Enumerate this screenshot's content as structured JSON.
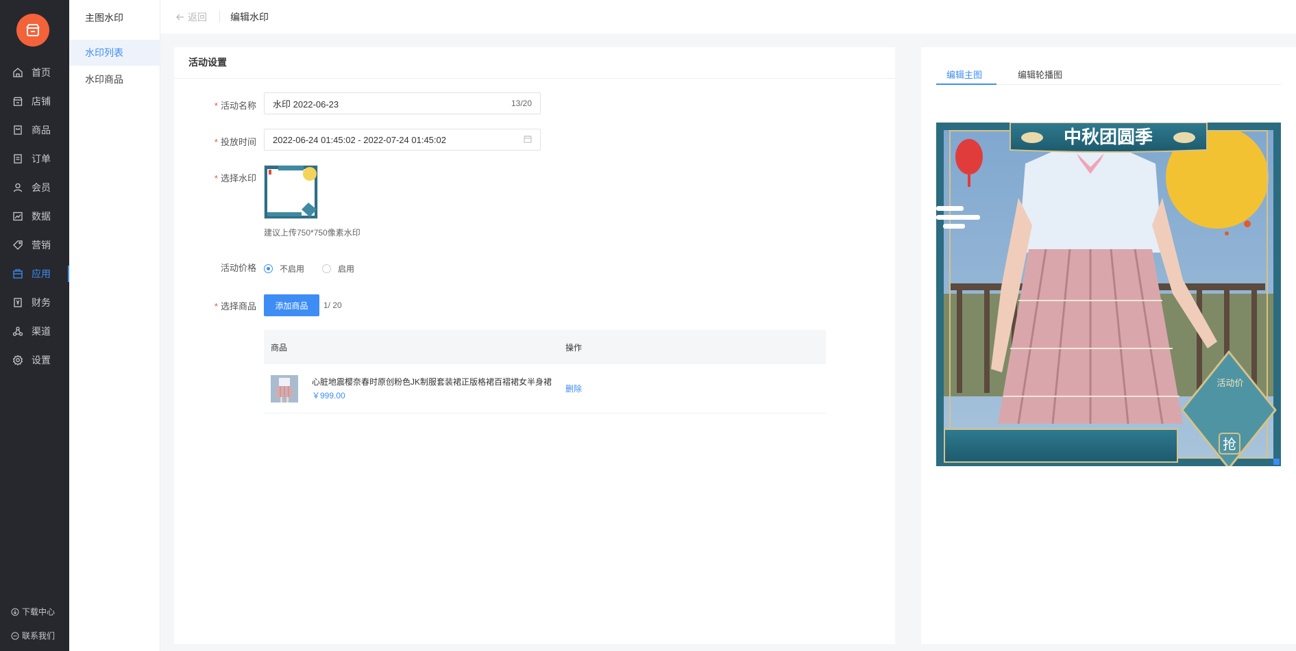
{
  "nav": {
    "items": [
      {
        "label": "首页",
        "icon": "home-icon"
      },
      {
        "label": "店铺",
        "icon": "store-icon"
      },
      {
        "label": "商品",
        "icon": "product-icon"
      },
      {
        "label": "订单",
        "icon": "order-icon"
      },
      {
        "label": "会员",
        "icon": "member-icon"
      },
      {
        "label": "数据",
        "icon": "chart-icon"
      },
      {
        "label": "营销",
        "icon": "tag-icon"
      },
      {
        "label": "应用",
        "icon": "app-icon",
        "active": true
      },
      {
        "label": "财务",
        "icon": "finance-icon"
      },
      {
        "label": "渠道",
        "icon": "channel-icon"
      },
      {
        "label": "设置",
        "icon": "gear-icon"
      }
    ],
    "footer": {
      "download": "下载中心",
      "contact": "联系我们"
    }
  },
  "subnav": {
    "title": "主图水印",
    "items": [
      {
        "label": "水印列表",
        "active": true
      },
      {
        "label": "水印商品"
      }
    ]
  },
  "topbar": {
    "back": "返回",
    "title": "编辑水印"
  },
  "form": {
    "card_title": "活动设置",
    "name_label": "活动名称",
    "name_value": "水印 2022-06-23",
    "name_count": "13/20",
    "time_label": "投放时间",
    "time_value": "2022-06-24 01:45:02 - 2022-07-24 01:45:02",
    "watermark_label": "选择水印",
    "watermark_hint": "建议上传750*750像素水印",
    "price_label": "活动价格",
    "price_options": {
      "off": "不启用",
      "on": "启用"
    },
    "product_label": "选择商品",
    "add_button": "添加商品",
    "product_count": "1/ 20",
    "table": {
      "headers": {
        "product": "商品",
        "action": "操作"
      },
      "rows": [
        {
          "name": "心脏地震樱奈春时原创粉色JK制服套装裙正版格裙百褶裙女半身裙",
          "price": "￥999.00",
          "action": "删除"
        }
      ]
    }
  },
  "preview": {
    "tabs": {
      "main": "编辑主图",
      "carousel": "编辑轮播图"
    },
    "banner_text": "中秋团圆季",
    "price_badge": "活动价",
    "grab": "抢"
  },
  "colors": {
    "accent": "#3d8df5",
    "nav_bg": "#27282d",
    "logo": "#f4623a",
    "required": "#f04b4b"
  }
}
